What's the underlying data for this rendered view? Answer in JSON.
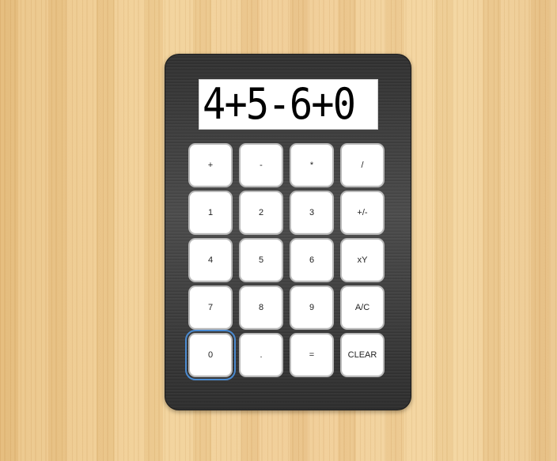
{
  "display": {
    "value": "4+5-6+0"
  },
  "keys": [
    {
      "label": "+",
      "name": "plus-key"
    },
    {
      "label": "-",
      "name": "minus-key"
    },
    {
      "label": "*",
      "name": "multiply-key"
    },
    {
      "label": "/",
      "name": "divide-key"
    },
    {
      "label": "1",
      "name": "digit-1-key"
    },
    {
      "label": "2",
      "name": "digit-2-key"
    },
    {
      "label": "3",
      "name": "digit-3-key"
    },
    {
      "label": "+/-",
      "name": "sign-toggle-key"
    },
    {
      "label": "4",
      "name": "digit-4-key"
    },
    {
      "label": "5",
      "name": "digit-5-key"
    },
    {
      "label": "6",
      "name": "digit-6-key"
    },
    {
      "label": "xY",
      "name": "power-key"
    },
    {
      "label": "7",
      "name": "digit-7-key"
    },
    {
      "label": "8",
      "name": "digit-8-key"
    },
    {
      "label": "9",
      "name": "digit-9-key"
    },
    {
      "label": "A/C",
      "name": "all-clear-key"
    },
    {
      "label": "0",
      "name": "digit-0-key"
    },
    {
      "label": ".",
      "name": "decimal-point-key"
    },
    {
      "label": "=",
      "name": "equals-key"
    },
    {
      "label": "CLEAR",
      "name": "clear-key"
    }
  ],
  "focused_key": "0",
  "colors": {
    "focus_ring": "#4a8ad0",
    "body": "#3a3a3a",
    "key_face": "#ffffff"
  }
}
